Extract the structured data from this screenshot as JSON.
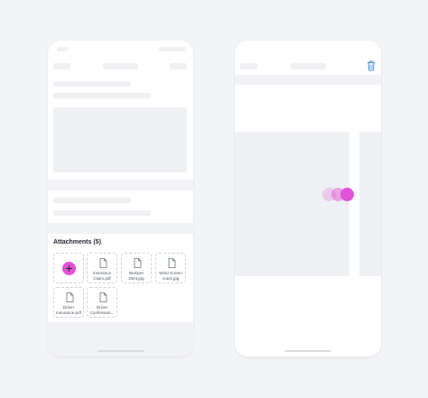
{
  "attachments": {
    "title": "Attachments (5)",
    "files": [
      {
        "name": "Insurance Claim.pdf"
      },
      {
        "name": "Bumper Dent.jpg"
      },
      {
        "name": "Wind screen crack.jpg"
      },
      {
        "name": "Driver Insurance.pdf"
      },
      {
        "name": "Driver Confession..."
      }
    ]
  },
  "colors": {
    "accent": "#e152d6",
    "trash": "#4a90e2",
    "skeleton": "#eef0f3"
  },
  "icons": {
    "add": "plus-icon",
    "file": "document-icon",
    "delete": "trash-icon",
    "loading": "loading-dots-icon"
  }
}
